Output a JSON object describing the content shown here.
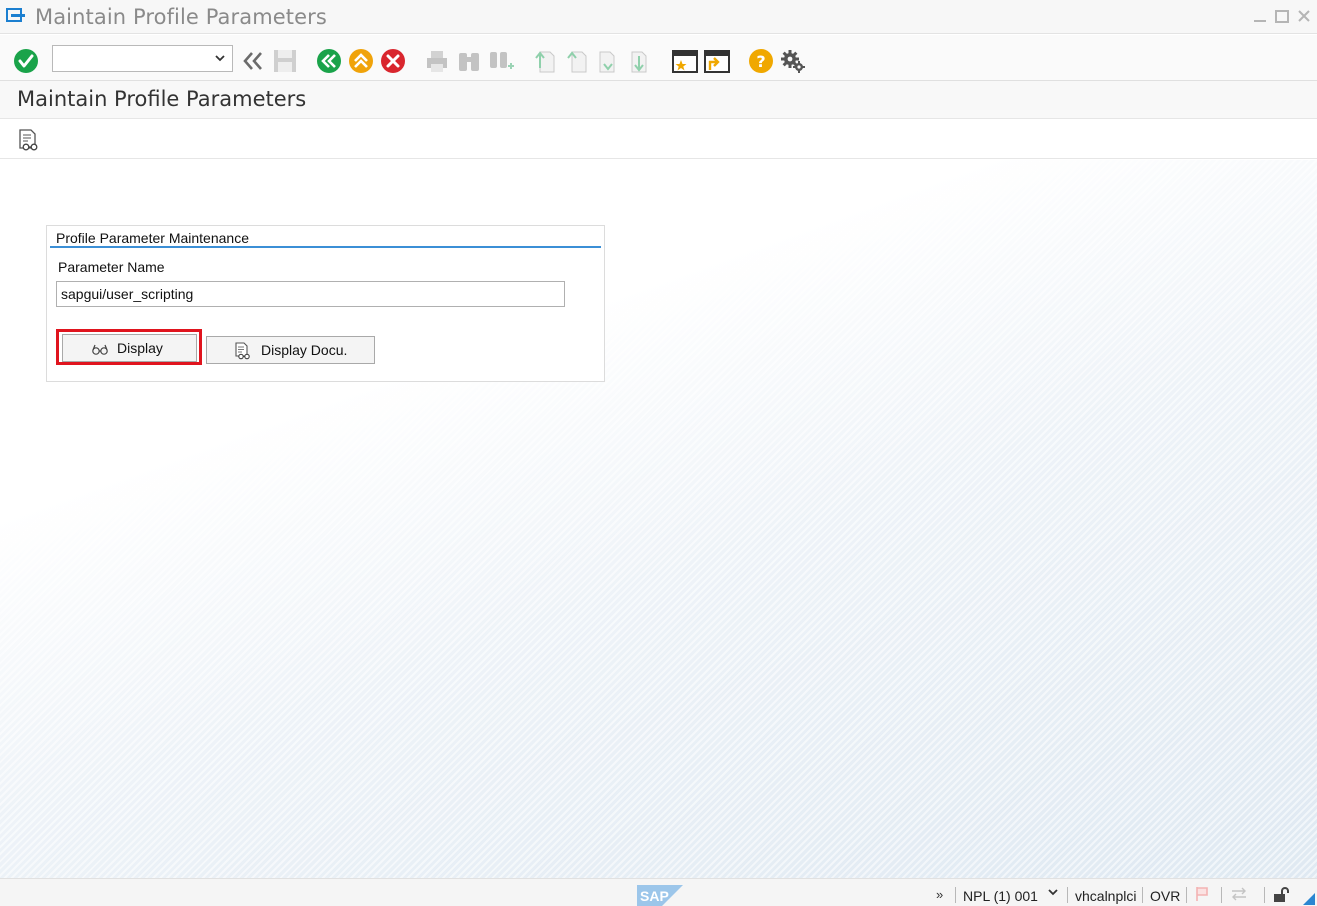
{
  "window": {
    "title": "Maintain Profile Parameters",
    "controls": [
      "minimize",
      "maximize",
      "close"
    ]
  },
  "toolbar": {
    "command_field": {
      "value": "",
      "placeholder": ""
    },
    "icons": [
      "enter-icon",
      "back-nav-icon",
      "save-icon",
      "back-icon",
      "exit-icon",
      "cancel-icon",
      "print-icon",
      "find-icon",
      "find-next-icon",
      "first-page-icon",
      "previous-page-icon",
      "next-page-icon",
      "last-page-icon",
      "create-session-icon",
      "generate-shortcut-icon",
      "help-icon",
      "customize-layout-icon"
    ]
  },
  "screen": {
    "title": "Maintain Profile Parameters"
  },
  "form": {
    "group_title": "Profile Parameter Maintenance",
    "parameter_label": "Parameter Name",
    "parameter_value": "sapgui/user_scripting",
    "display_button": "Display",
    "display_docu_button": "Display Docu."
  },
  "statusbar": {
    "more": "»",
    "system": "NPL (1) 001",
    "host": "vhcalnplci",
    "mode": "OVR"
  },
  "colors": {
    "accent": "#3b8fd6",
    "highlight": "#e0141e",
    "enter_green": "#1aa34a",
    "exit_orange": "#f0a30a",
    "cancel_red": "#d9262e",
    "help_yellow": "#f0a800"
  }
}
